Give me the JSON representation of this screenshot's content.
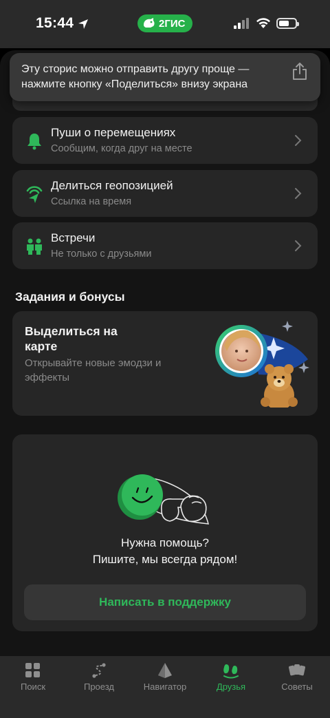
{
  "status_bar": {
    "time": "15:44",
    "brand_label": "2ГИС"
  },
  "toast": {
    "text": "Эту сторис можно отправить другу проще — нажмите кнопку «Поделиться» внизу экрана",
    "icon": "share-icon"
  },
  "menu": {
    "items": [
      {
        "title": "Пуши о перемещениях",
        "subtitle": "Сообщим, когда друг на месте",
        "icon": "bell-icon"
      },
      {
        "title": "Делиться геопозицией",
        "subtitle": "Ссылка на время",
        "icon": "location-share-icon"
      },
      {
        "title": "Встречи",
        "subtitle": "Не только с друзьями",
        "icon": "people-icon"
      }
    ]
  },
  "tasks": {
    "section_title": "Задания и бонусы",
    "promo": {
      "title": "Выделиться на карте",
      "subtitle": "Открывайте новые эмодзи и эффекты"
    }
  },
  "help": {
    "line1": "Нужна помощь?",
    "line2": "Пишите, мы всегда рядом!",
    "button_label": "Написать в поддержку"
  },
  "tab_bar": {
    "tabs": [
      {
        "label": "Поиск",
        "icon": "grid-icon"
      },
      {
        "label": "Проезд",
        "icon": "route-icon"
      },
      {
        "label": "Навигатор",
        "icon": "navigator-icon"
      },
      {
        "label": "Друзья",
        "icon": "friends-icon",
        "active": true
      },
      {
        "label": "Советы",
        "icon": "cards-icon"
      }
    ]
  },
  "colors": {
    "accent": "#2fb85a",
    "brand": "#26b14a",
    "background": "#141414",
    "card": "#262626"
  }
}
